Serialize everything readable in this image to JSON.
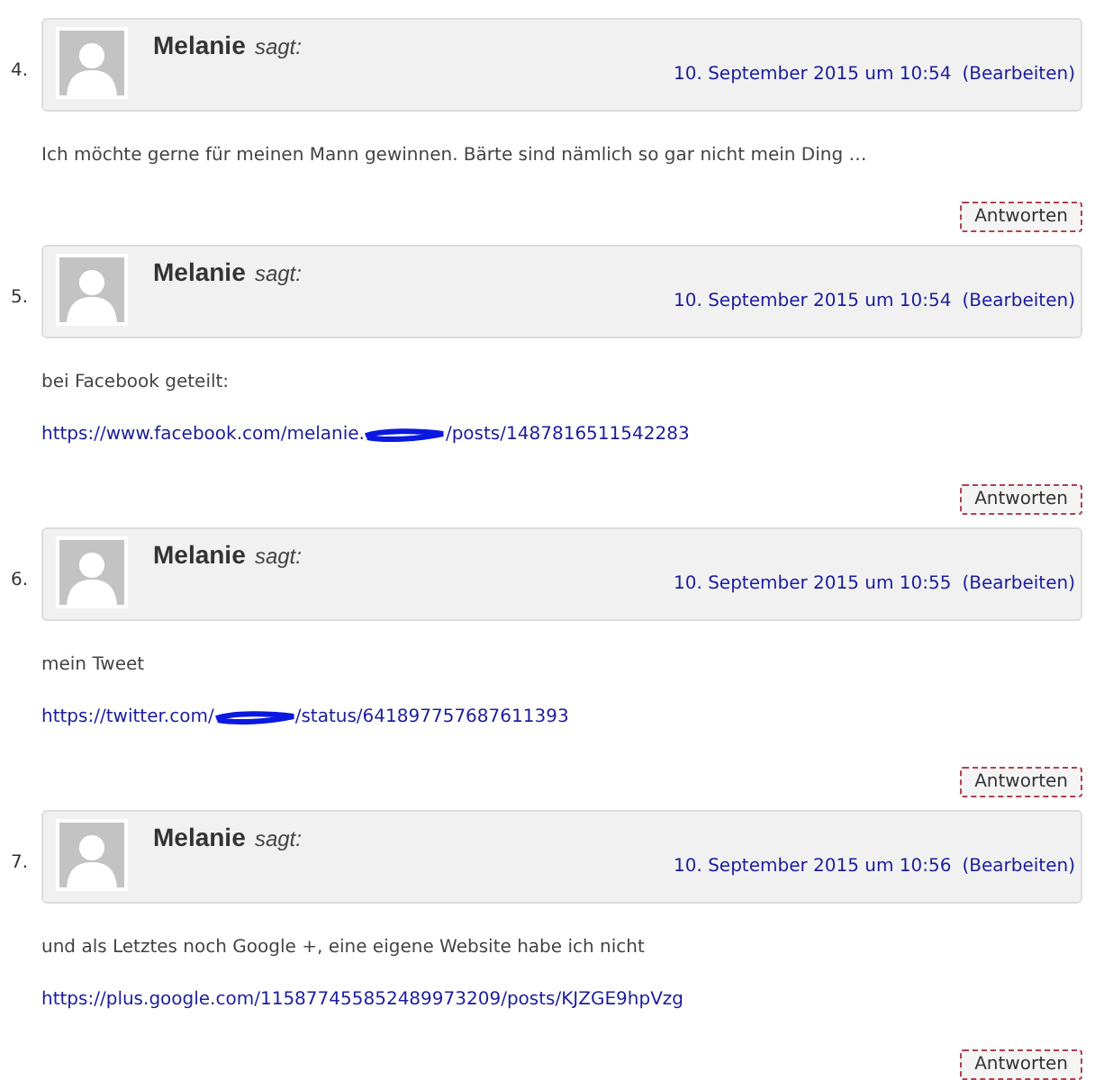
{
  "comments": [
    {
      "number": "4.",
      "author": "Melanie",
      "says": "sagt:",
      "date": "10. September 2015 um 10:54",
      "edit_link": "(Bearbeiten)",
      "paragraphs": [
        {
          "kind": "text",
          "text": "Ich möchte gerne für meinen Mann gewinnen. Bärte sind nämlich so gar nicht mein Ding …"
        }
      ],
      "reply_button": "Antworten"
    },
    {
      "number": "5.",
      "author": "Melanie",
      "says": "sagt:",
      "date": "10. September 2015 um 10:54",
      "edit_link": "(Bearbeiten)",
      "paragraphs": [
        {
          "kind": "text",
          "text": "bei Facebook geteilt:"
        },
        {
          "kind": "redacted_link",
          "before": "https://www.facebook.com/melanie.",
          "after": "/posts/1487816511542283"
        }
      ],
      "reply_button": "Antworten"
    },
    {
      "number": "6.",
      "author": "Melanie",
      "says": "sagt:",
      "date": "10. September 2015 um 10:55",
      "edit_link": "(Bearbeiten)",
      "paragraphs": [
        {
          "kind": "text",
          "text": "mein Tweet"
        },
        {
          "kind": "redacted_link",
          "before": "https://twitter.com/",
          "after": "/status/641897757687611393"
        }
      ],
      "reply_button": "Antworten"
    },
    {
      "number": "7.",
      "author": "Melanie",
      "says": "sagt:",
      "date": "10. September 2015 um 10:56",
      "edit_link": "(Bearbeiten)",
      "paragraphs": [
        {
          "kind": "text",
          "text": "und als Letztes noch Google +, eine eigene Website habe ich nicht"
        },
        {
          "kind": "link",
          "text": "https://plus.google.com/115877455852489973209/posts/KJZGE9hpVzg"
        }
      ],
      "reply_button": "Antworten"
    }
  ]
}
